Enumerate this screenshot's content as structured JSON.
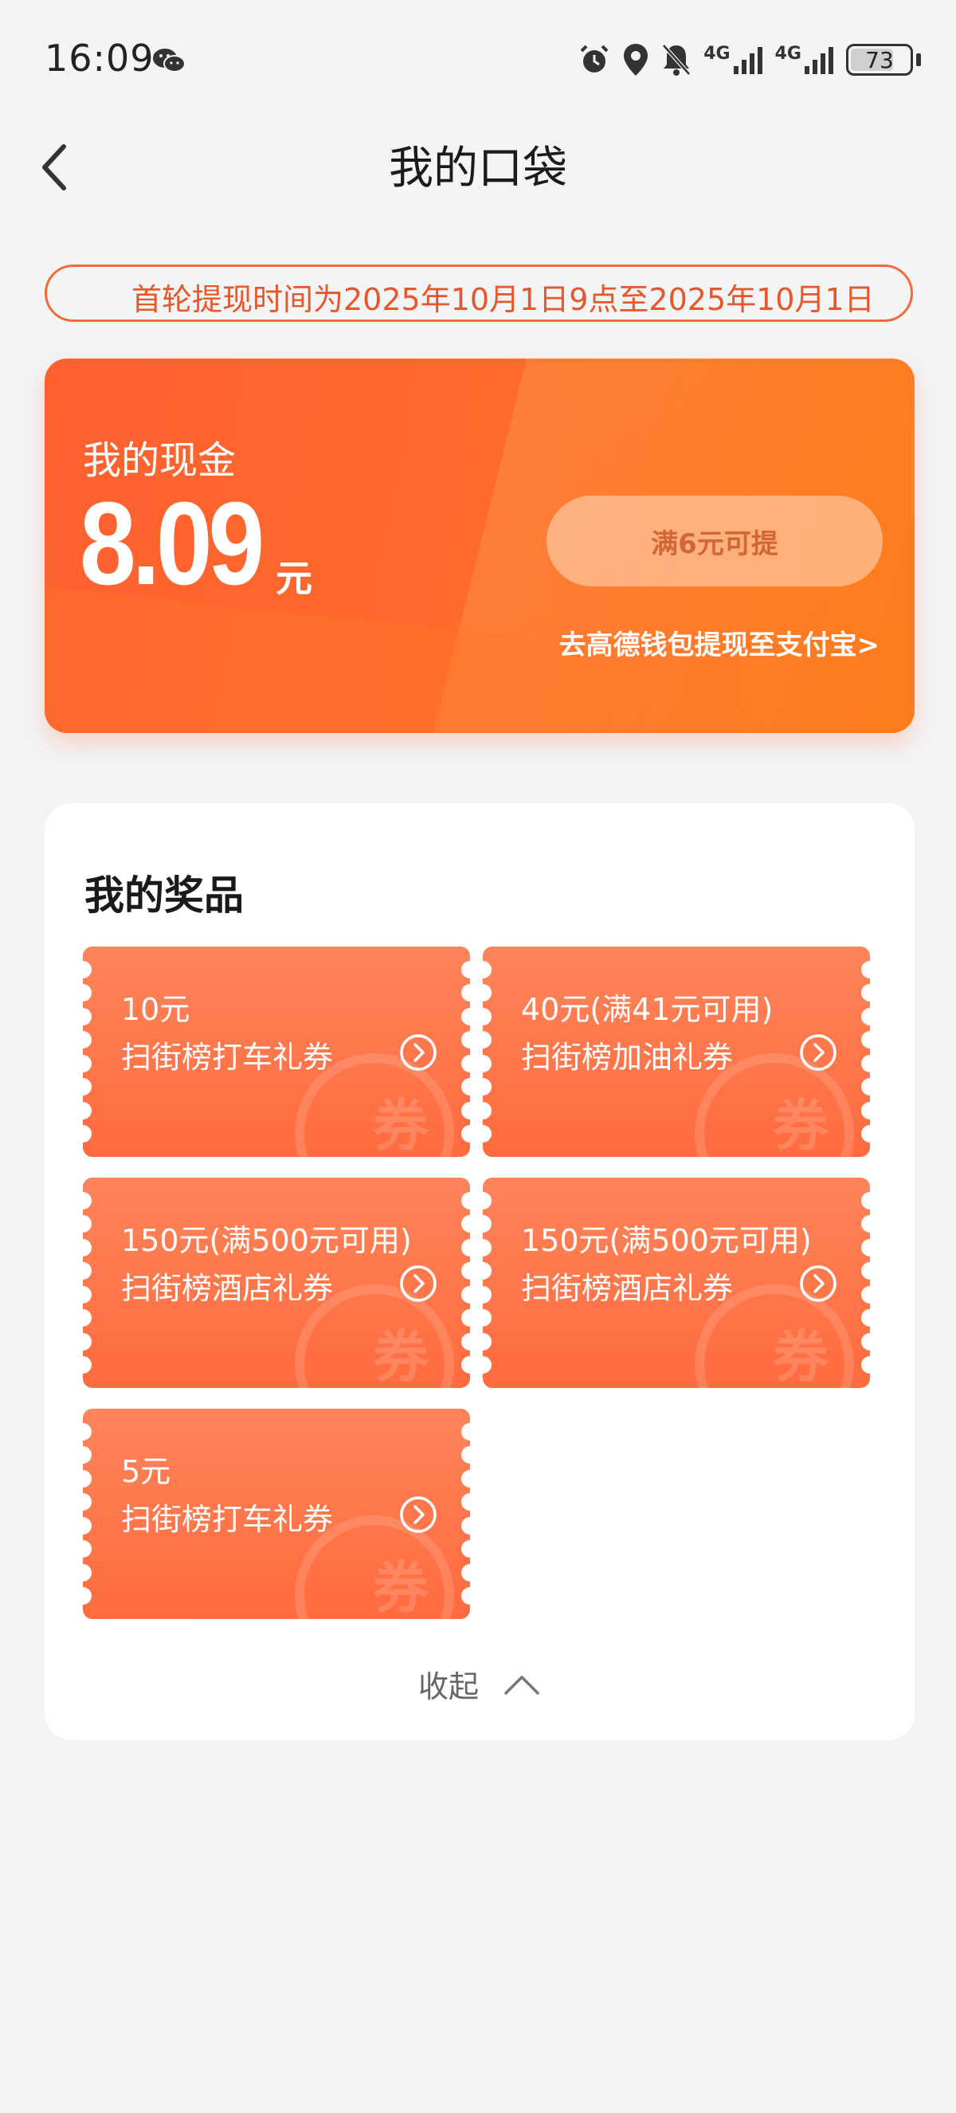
{
  "status_bar": {
    "time": "16:09",
    "network_1": "4G",
    "network_2": "4G",
    "battery": "73",
    "battery_level": 0.73
  },
  "nav": {
    "title": "我的口袋"
  },
  "notice": {
    "text": "首轮提现时间为2025年10月1日9点至2025年10月1日"
  },
  "cash": {
    "label": "我的现金",
    "amount": "8.09",
    "unit": "元",
    "withdraw_button": "满6元可提",
    "alipay_link": "去高德钱包提现至支付宝>"
  },
  "prizes": {
    "title": "我的奖品",
    "watermark": "券",
    "items": [
      {
        "amount": "10元",
        "name": "扫街榜打车礼券"
      },
      {
        "amount": "40元(满41元可用)",
        "name": "扫街榜加油礼券"
      },
      {
        "amount": "150元(满500元可用)",
        "name": "扫街榜酒店礼券"
      },
      {
        "amount": "150元(满500元可用)",
        "name": "扫街榜酒店礼券"
      },
      {
        "amount": "5元",
        "name": "扫街榜打车礼券"
      }
    ],
    "collapse_label": "收起"
  },
  "colors": {
    "accent": "#ff6a2c",
    "notice": "#e8572a",
    "coupon": "#ff7a4c"
  }
}
